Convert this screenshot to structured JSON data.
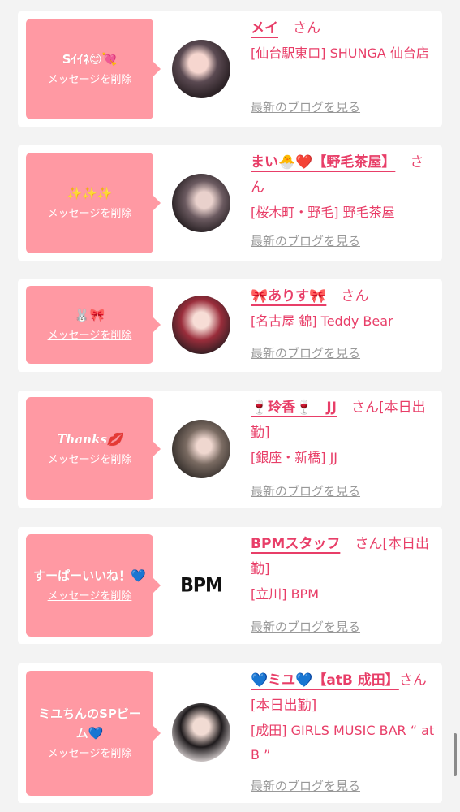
{
  "delete_label": "メッセージを削除",
  "blog_label": "最新のブログを見る",
  "honorific": "さん",
  "accent_color": "#e83e68",
  "bubble_color": "#ff99a3",
  "items": [
    {
      "message": "Sｲｲﾈ😊💘",
      "name": "メイ",
      "suffix": "",
      "shop": "[仙台駅東口] SHUNGA 仙台店",
      "avatar": "photo"
    },
    {
      "message": "✨✨✨",
      "name": "まい🐣❤️【野毛茶屋】",
      "suffix": "",
      "shop": "[桜木町・野毛] 野毛茶屋",
      "avatar": "photo"
    },
    {
      "message": "🐰🎀",
      "name": "🎀ありす🎀",
      "suffix": "",
      "shop": "[名古屋 錦] Teddy Bear",
      "avatar": "photo"
    },
    {
      "message": "Thanks💋",
      "name": "🍷玲香🍷　JJ",
      "suffix": "[本日出勤]",
      "shop": "[銀座・新橋] JJ",
      "avatar": "photo"
    },
    {
      "message": "すーぱーいいね！💙",
      "name": "BPMスタッフ",
      "suffix": "[本日出勤]",
      "shop": "[立川] BPM",
      "avatar": "BPM"
    },
    {
      "message": "ミユちんのSPビーム💙",
      "name": "💙ミユ💙【atB 成田】",
      "suffix": "[本日出勤]",
      "shop": "[成田] GIRLS MUSIC BAR “ at B ”",
      "avatar": "photo"
    }
  ]
}
